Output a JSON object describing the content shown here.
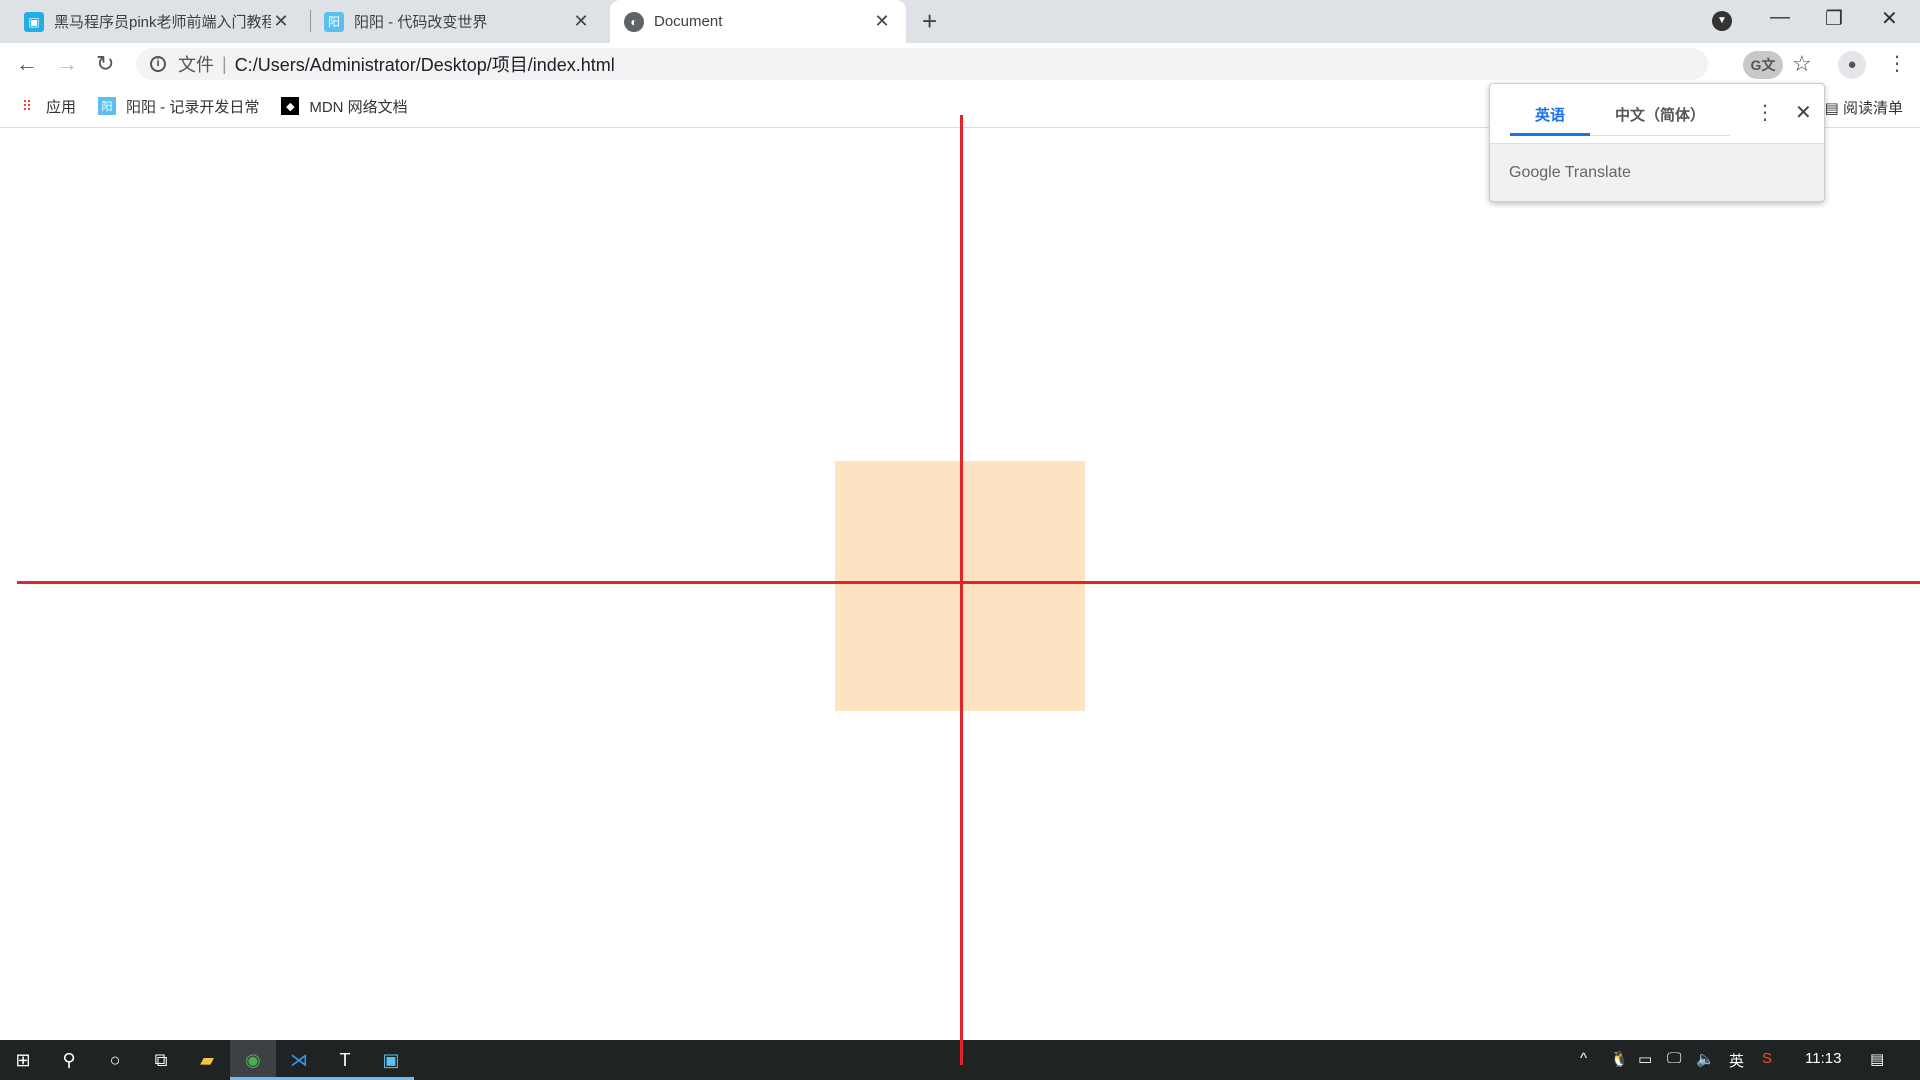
{
  "browser": {
    "tabs": [
      {
        "title": "黑马程序员pink老师前端入门教程",
        "icon": "bilibili-icon",
        "active": false
      },
      {
        "title": "阳阳 - 代码改变世界",
        "icon": "cnblogs-icon",
        "active": false
      },
      {
        "title": "Document",
        "icon": "globe-icon",
        "active": true
      }
    ],
    "new_tab": "+",
    "close_glyph": "✕",
    "address": {
      "scheme_label": "文件",
      "url": "C:/Users/Administrator/Desktop/项目/index.html"
    },
    "bookmarks": [
      {
        "label": "应用",
        "icon": "apps-grid-icon"
      },
      {
        "label": "阳阳 - 记录开发日常",
        "icon": "cnblogs-icon"
      },
      {
        "label": "MDN 网络文档",
        "icon": "mdn-icon"
      }
    ],
    "reading_list": "阅读清单"
  },
  "translate_popup": {
    "tabs": [
      "英语",
      "中文（简体）"
    ],
    "active_tab": 0,
    "footer": "Google Translate",
    "accent": "#1a73e8"
  },
  "page": {
    "box_color": "#fde3c1",
    "line_color": "#e3242b"
  },
  "taskbar": {
    "clock": "11:13",
    "ime": "英"
  }
}
